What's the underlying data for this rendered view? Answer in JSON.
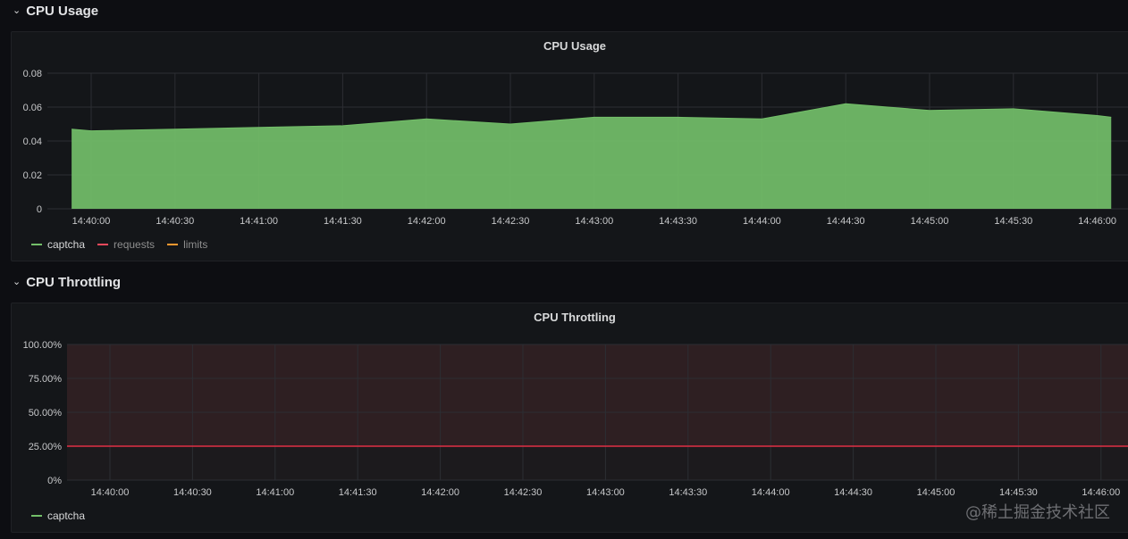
{
  "rows": {
    "cpu_usage": {
      "chevron": "⌄",
      "title": "CPU Usage"
    },
    "cpu_throttling": {
      "chevron": "⌄",
      "title": "CPU Throttling"
    }
  },
  "panels": {
    "cpu_usage": {
      "title": "CPU Usage",
      "legend": [
        {
          "label": "captcha",
          "color": "#73bf69",
          "active": true
        },
        {
          "label": "requests",
          "color": "#f2495c",
          "active": false
        },
        {
          "label": "limits",
          "color": "#ff9830",
          "active": false
        }
      ]
    },
    "cpu_throttling": {
      "title": "CPU Throttling",
      "legend": [
        {
          "label": "captcha",
          "color": "#73bf69",
          "active": true
        }
      ]
    }
  },
  "watermark": "@稀土掘金技术社区",
  "chart_data": [
    {
      "type": "area",
      "title": "CPU Usage",
      "x_ticks": [
        "14:40:00",
        "14:40:30",
        "14:41:00",
        "14:41:30",
        "14:42:00",
        "14:42:30",
        "14:43:00",
        "14:43:30",
        "14:44:00",
        "14:44:30",
        "14:45:00",
        "14:45:30",
        "14:46:00"
      ],
      "y_ticks": [
        "0",
        "0.02",
        "0.04",
        "0.06",
        "0.08"
      ],
      "ylim": [
        0,
        0.08
      ],
      "x": [
        "14:39:53",
        "14:40:00",
        "14:40:30",
        "14:41:00",
        "14:41:30",
        "14:42:00",
        "14:42:30",
        "14:43:00",
        "14:43:30",
        "14:44:00",
        "14:44:30",
        "14:45:00",
        "14:45:30",
        "14:46:00",
        "14:46:05"
      ],
      "series": [
        {
          "name": "captcha",
          "color": "#73bf69",
          "values": [
            0.047,
            0.046,
            0.047,
            0.048,
            0.049,
            0.053,
            0.05,
            0.054,
            0.054,
            0.053,
            0.062,
            0.058,
            0.059,
            0.055,
            0.054
          ]
        }
      ],
      "grid": true,
      "legend_position": "bottom-left"
    },
    {
      "type": "line",
      "title": "CPU Throttling",
      "x_ticks": [
        "14:40:00",
        "14:40:30",
        "14:41:00",
        "14:41:30",
        "14:42:00",
        "14:42:30",
        "14:43:00",
        "14:43:30",
        "14:44:00",
        "14:44:30",
        "14:45:00",
        "14:45:30",
        "14:46:00"
      ],
      "y_ticks": [
        "0%",
        "25.00%",
        "50.00%",
        "75.00%",
        "100.00%"
      ],
      "ylim": [
        0,
        100
      ],
      "threshold": {
        "value": 25,
        "color": "#e02f44",
        "fill_above": true
      },
      "grid": true,
      "legend_position": "bottom-left"
    }
  ]
}
